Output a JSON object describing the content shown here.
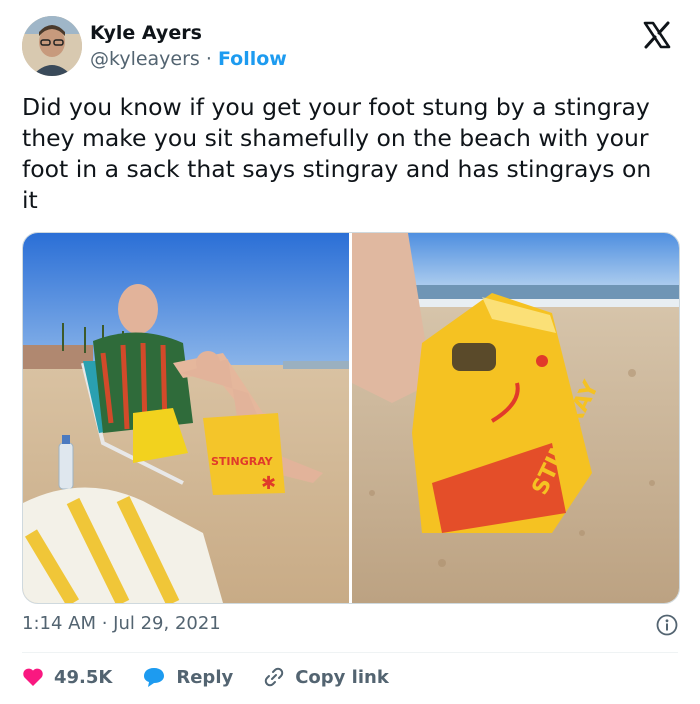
{
  "author": {
    "name": "Kyle Ayers",
    "handle": "@kyleayers",
    "separator": "·",
    "follow_label": "Follow"
  },
  "tweet": {
    "text": "Did you know if you get your foot stung by a stingray they make you sit shamefully on the beach with your foot in a sack that says stingray and has stingrays on it"
  },
  "media": {
    "bag_text_left": "STINGRAY",
    "bag_text_right": "STINGRAY"
  },
  "meta": {
    "timestamp": "1:14 AM · Jul 29, 2021"
  },
  "actions": {
    "like_count": "49.5K",
    "reply_label": "Reply",
    "copy_label": "Copy link"
  },
  "colors": {
    "accent": "#1d9bf0",
    "like": "#f91880",
    "text": "#0f1419",
    "muted": "#536471"
  },
  "icons": {
    "logo": "x-logo-icon",
    "info": "info-icon",
    "like": "heart-icon",
    "reply": "reply-bubble-icon",
    "copy": "link-icon"
  }
}
